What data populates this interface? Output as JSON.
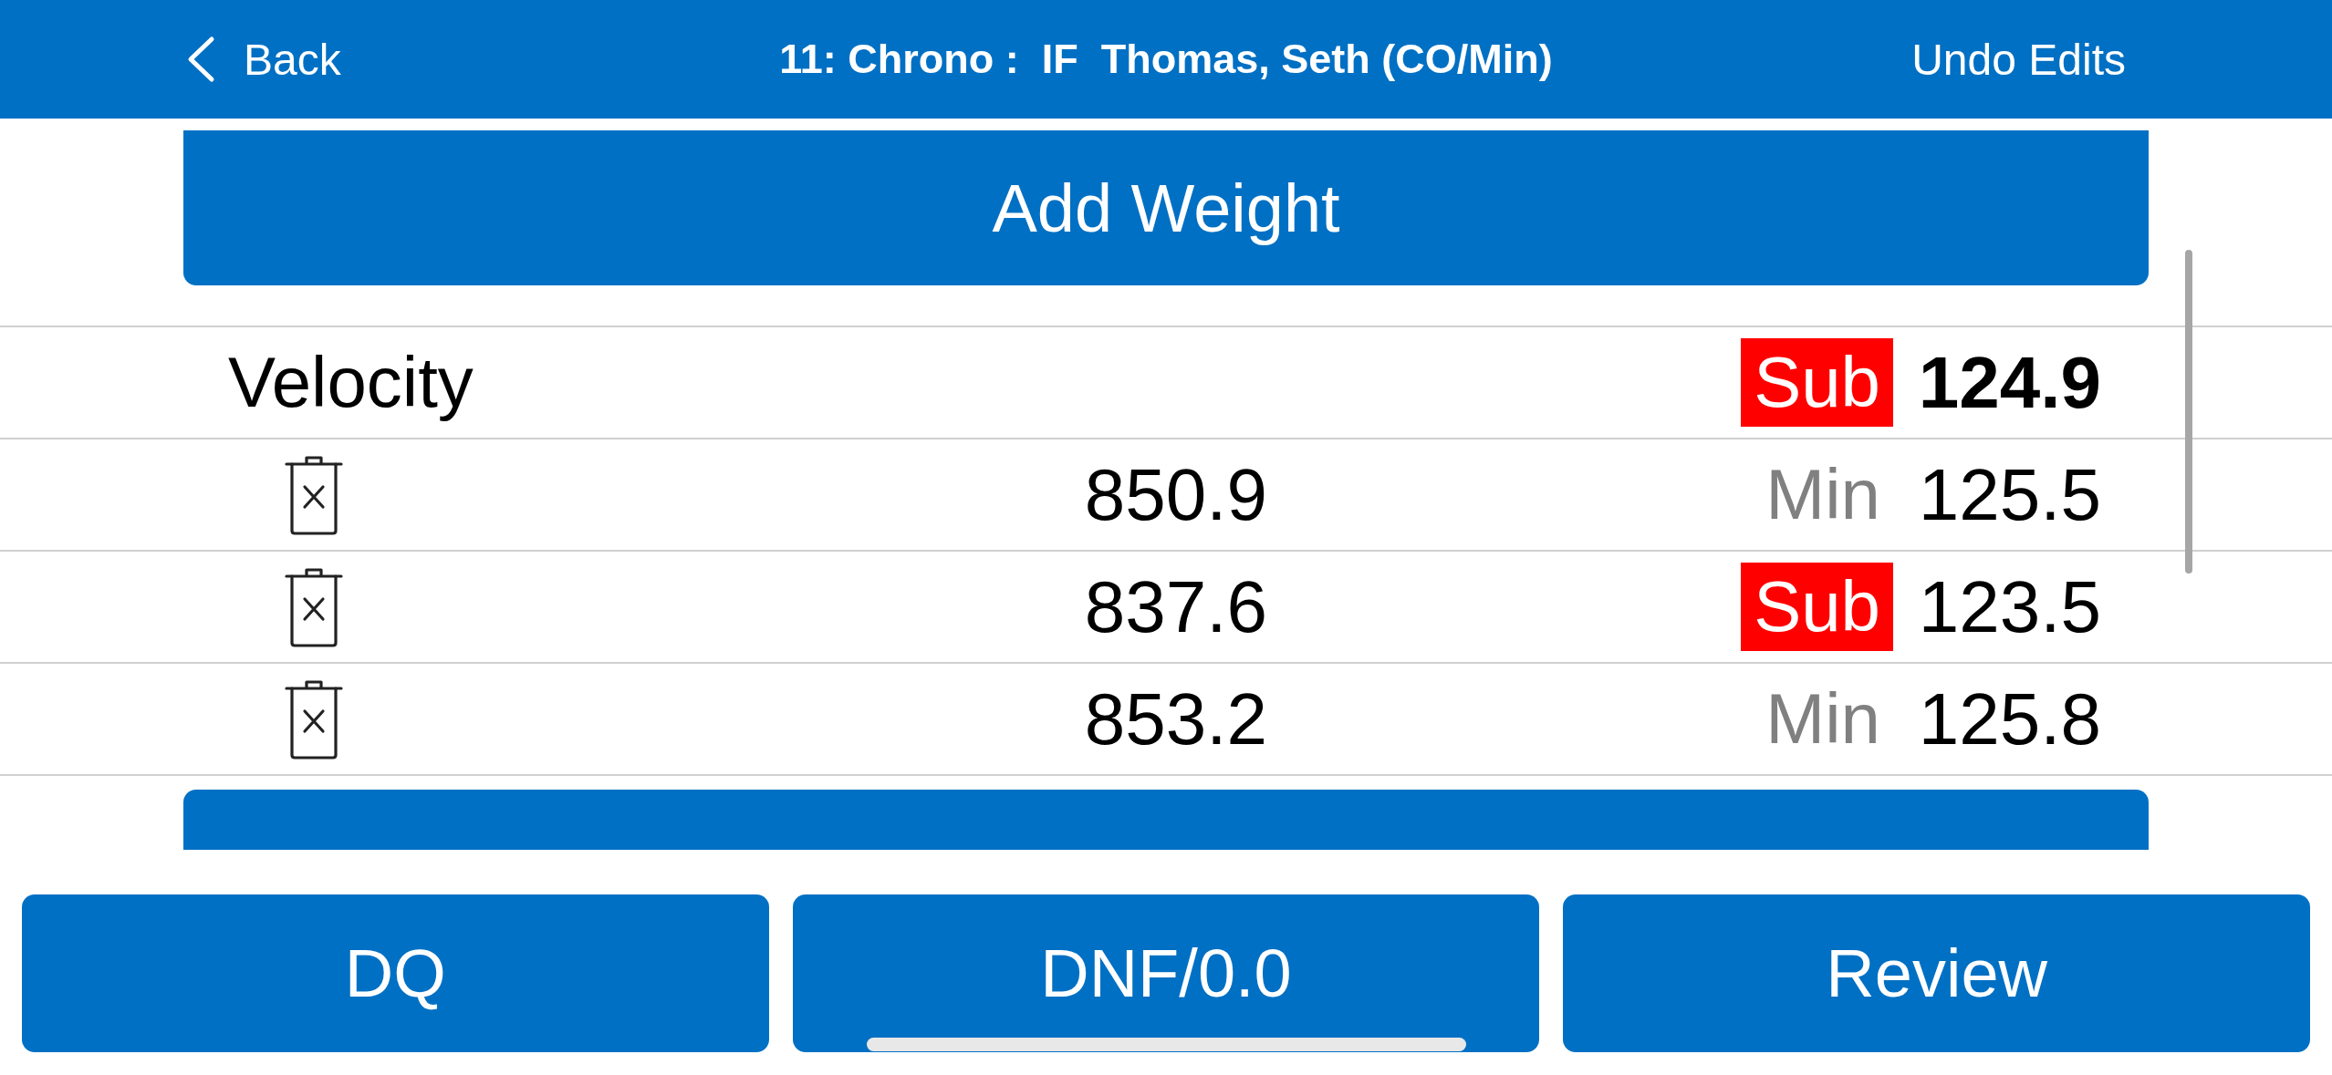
{
  "nav_bar": {
    "back_label": "Back",
    "title": "11: Chrono :  IF  Thomas, Seth (CO/Min)",
    "action": "Undo Edits"
  },
  "add_weight_button": "Add Weight",
  "velocity": {
    "label": "Velocity",
    "summary": {
      "tag": "Sub",
      "kind": "sub",
      "value": "124.9"
    },
    "readings": [
      {
        "value": "850.9",
        "tag": "Min",
        "kind": "min",
        "score": "125.5"
      },
      {
        "value": "837.6",
        "tag": "Sub",
        "kind": "sub",
        "score": "123.5"
      },
      {
        "value": "853.2",
        "tag": "Min",
        "kind": "min",
        "score": "125.8"
      }
    ]
  },
  "bottom_buttons": [
    "DQ",
    "DNF/0.0",
    "Review"
  ]
}
